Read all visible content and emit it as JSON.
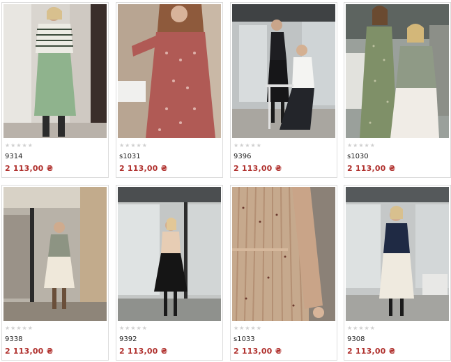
{
  "products": [
    {
      "code": "9314",
      "price": "2 113,00",
      "currency": "₴",
      "rating": 0,
      "max_rating": 5
    },
    {
      "code": "s1031",
      "price": "2 113,00",
      "currency": "₴",
      "rating": 0,
      "max_rating": 5
    },
    {
      "code": "9396",
      "price": "2 113,00",
      "currency": "₴",
      "rating": 0,
      "max_rating": 5
    },
    {
      "code": "s1030",
      "price": "2 113,00",
      "currency": "₴",
      "rating": 0,
      "max_rating": 5
    },
    {
      "code": "9338",
      "price": "2 113,00",
      "currency": "₴",
      "rating": 0,
      "max_rating": 5
    },
    {
      "code": "9392",
      "price": "2 113,00",
      "currency": "₴",
      "rating": 0,
      "max_rating": 5
    },
    {
      "code": "s1033",
      "price": "2 113,00",
      "currency": "₴",
      "rating": 0,
      "max_rating": 5
    },
    {
      "code": "9308",
      "price": "2 113,00",
      "currency": "₴",
      "rating": 0,
      "max_rating": 5
    }
  ],
  "colors": {
    "price": "#b0312e",
    "star_empty": "#cfcfcf",
    "card_border": "#dcdcdc"
  }
}
